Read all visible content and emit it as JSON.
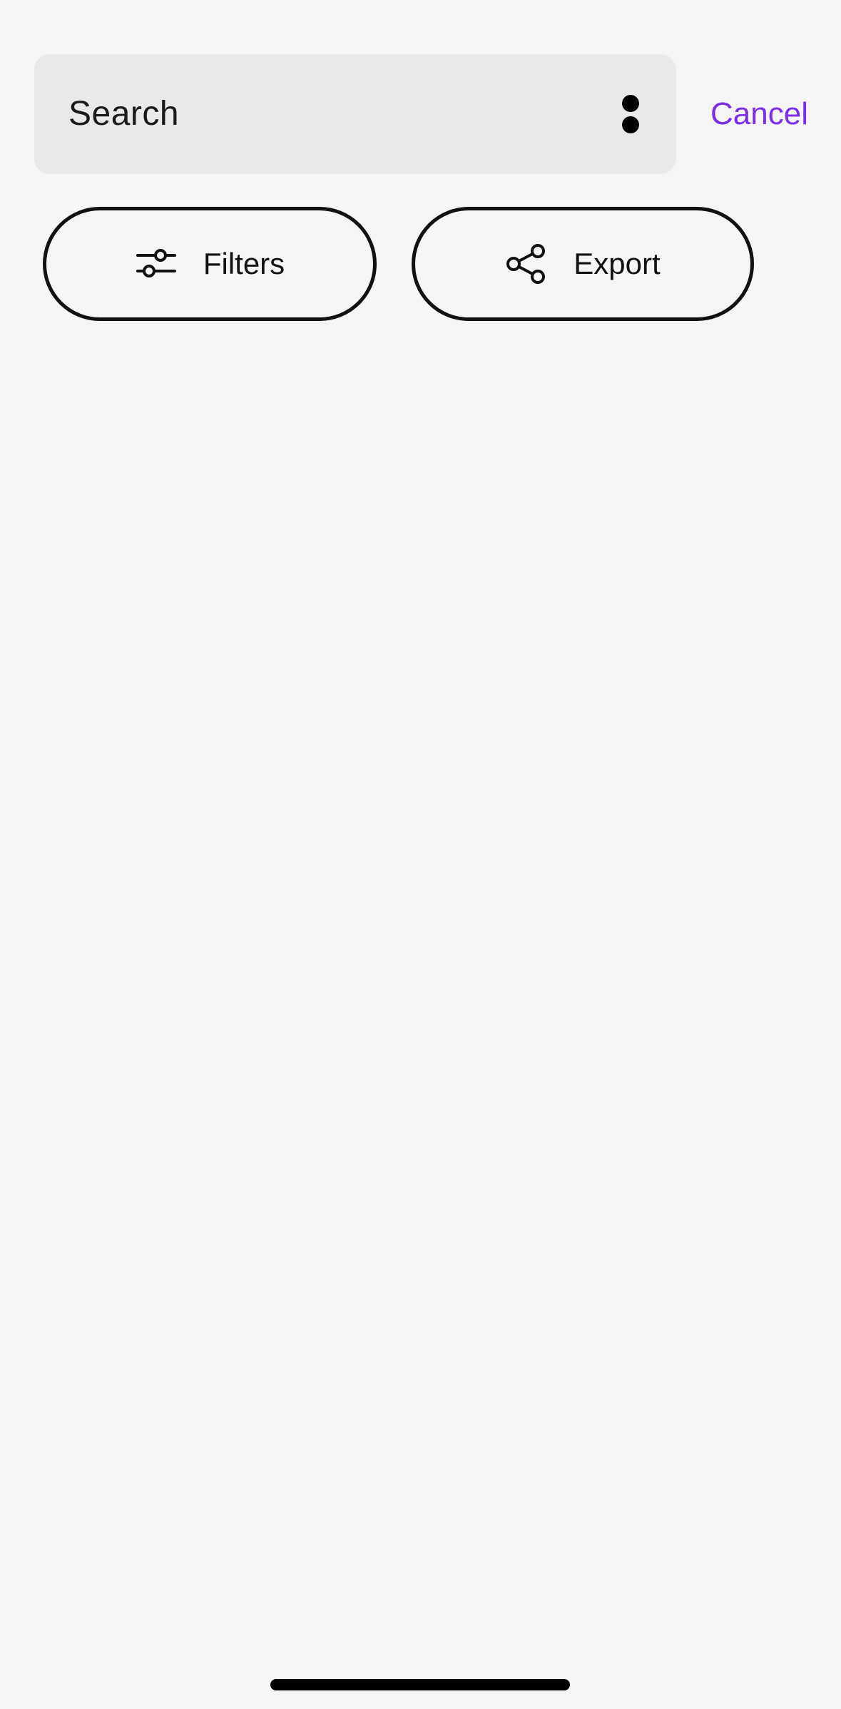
{
  "search": {
    "placeholder": "Search",
    "more_icon": "more-vertical-icon"
  },
  "cancel_label": "Cancel",
  "actions": {
    "filters": {
      "label": "Filters",
      "icon": "sliders-icon"
    },
    "export": {
      "label": "Export",
      "icon": "share-icon"
    }
  },
  "colors": {
    "background": "#f5f5f5",
    "search_background": "#e9e9e9",
    "accent": "#7a2ee6",
    "text": "#111111"
  }
}
